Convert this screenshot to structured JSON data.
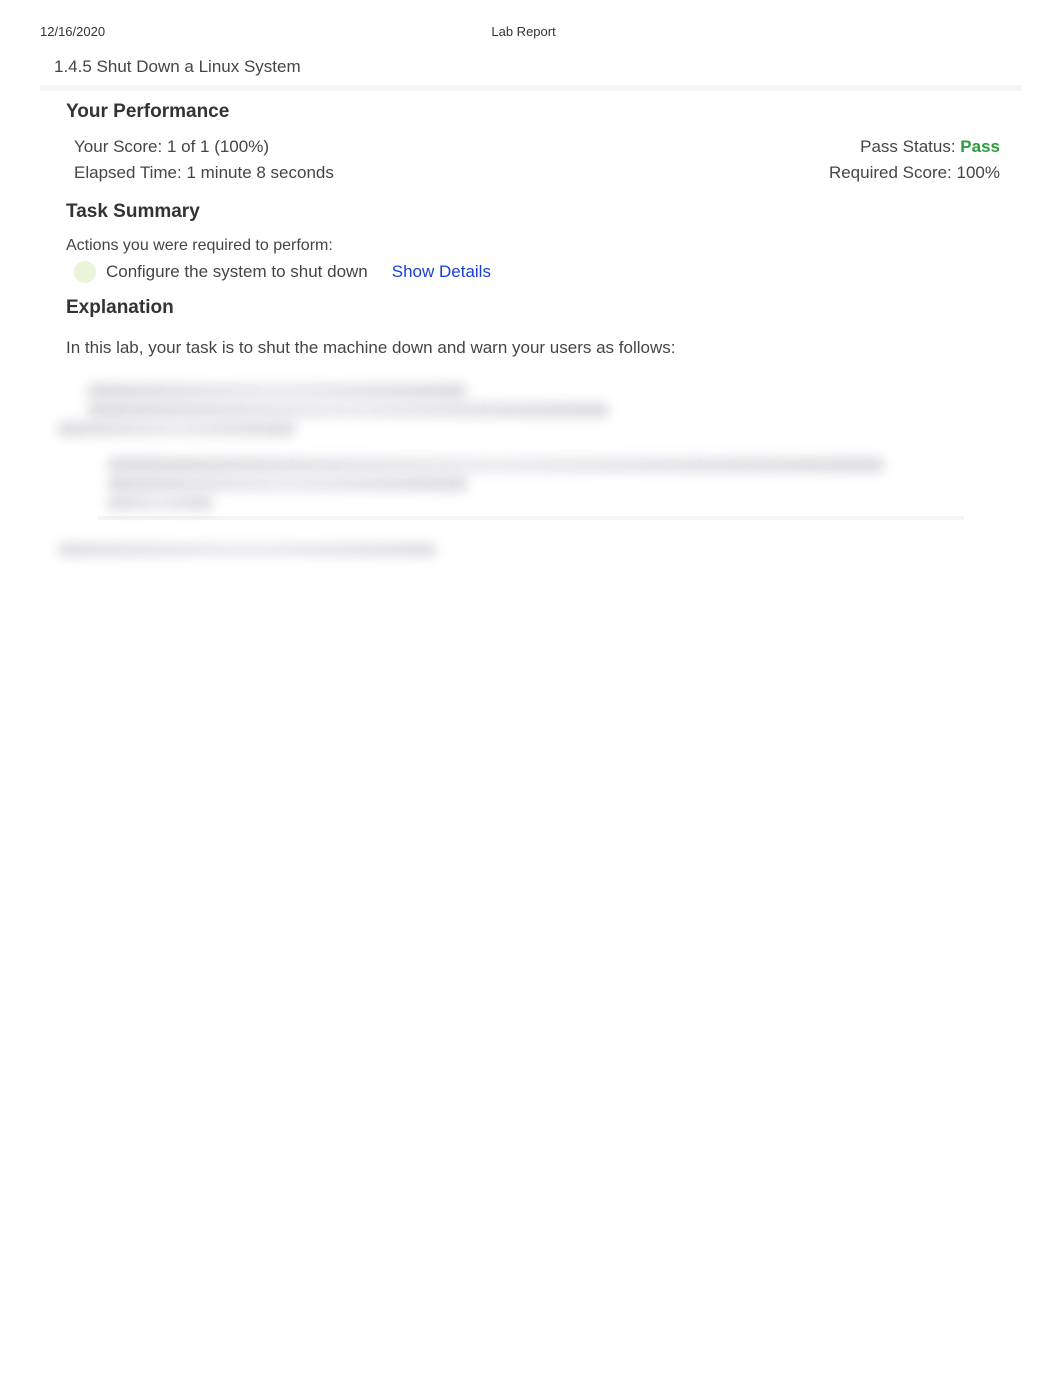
{
  "header": {
    "date": "12/16/2020",
    "title": "Lab Report"
  },
  "lab": {
    "title": "1.4.5 Shut Down a Linux System"
  },
  "performance": {
    "heading": "Your Performance",
    "score_label": "Your Score: ",
    "score_value": "1 of 1 (100%)",
    "pass_label": "Pass Status: ",
    "pass_value": "Pass",
    "elapsed_label": "Elapsed Time: ",
    "elapsed_value": "1 minute 8 seconds",
    "required_label": "Required Score: ",
    "required_value": "100%"
  },
  "task_summary": {
    "heading": "Task Summary",
    "actions_label": "Actions you were required to perform:",
    "items": [
      {
        "status": "complete",
        "text": "Configure the system to shut down",
        "details_link": "Show Details"
      }
    ]
  },
  "explanation": {
    "heading": "Explanation",
    "intro": "In this lab, your task is to shut the machine down and warn your users as follows:"
  }
}
